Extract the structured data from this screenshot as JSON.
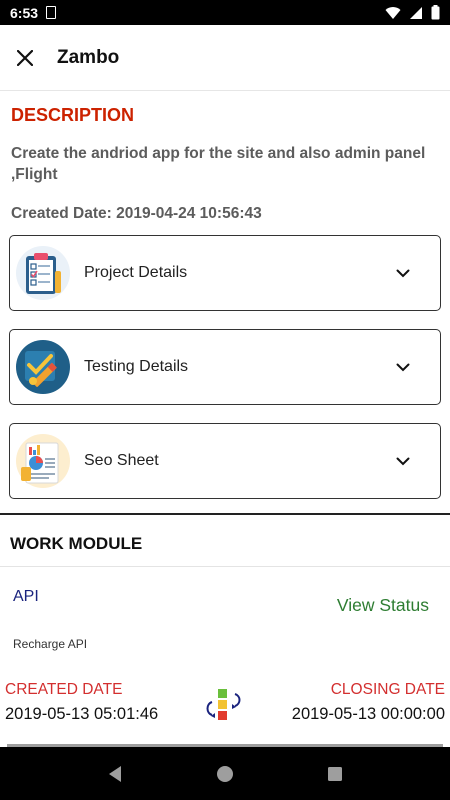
{
  "status_bar": {
    "time": "6:53"
  },
  "header": {
    "title": "Zambo"
  },
  "description": {
    "heading": "DESCRIPTION",
    "text": "Create the andriod app for the site and also admin panel ,Flight",
    "created": "Created Date: 2019-04-24 10:56:43"
  },
  "sections": [
    {
      "label": "Project Details",
      "icon": "clipboard-checklist-icon"
    },
    {
      "label": "Testing Details",
      "icon": "pencil-check-icon"
    },
    {
      "label": "Seo Sheet",
      "icon": "report-charts-icon"
    }
  ],
  "work_module": {
    "heading": "WORK MODULE",
    "items": [
      {
        "name": "API",
        "subtitle": "Recharge API",
        "view_status": "View Status",
        "created_label": "CREATED DATE",
        "created_value": "2019-05-13 05:01:46",
        "closing_label": "CLOSING DATE",
        "closing_value": "2019-05-13 00:00:00"
      }
    ]
  },
  "colors": {
    "accent_red": "#cc2200",
    "module_blue": "#1a237e",
    "status_green": "#2e7d32",
    "date_label_red": "#d32f2f"
  }
}
